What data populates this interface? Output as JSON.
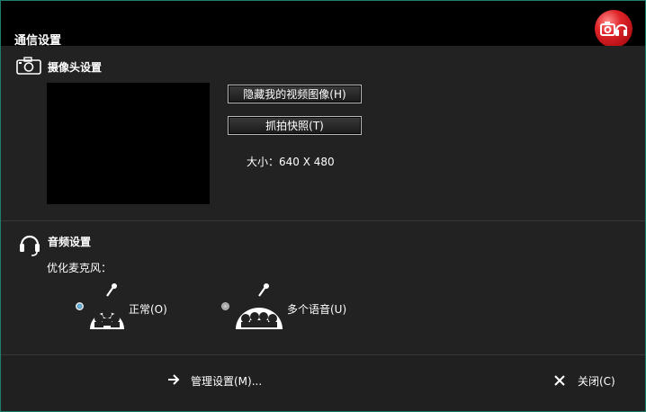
{
  "window": {
    "title": "通信设置"
  },
  "camera": {
    "section_title": "摄像头设置",
    "hide_video_button": "隐藏我的视频图像(H)",
    "snapshot_button": "抓拍快照(T)",
    "size_label": "大小：640 X 480"
  },
  "audio": {
    "section_title": "音频设置",
    "optimize_label": "优化麦克风：",
    "options": [
      {
        "label": "正常(O)",
        "selected": true
      },
      {
        "label": "多个语音(U)",
        "selected": false
      }
    ]
  },
  "footer": {
    "manage_label": "管理设置(M)...",
    "close_label": "关闭(C)"
  },
  "colors": {
    "border": "#1f7d6e",
    "background": "#202020",
    "accent": "#e0262a"
  },
  "icons": [
    "camera-icon",
    "headset-icon",
    "mic-group-icon",
    "arrow-right-icon",
    "close-icon",
    "app-logo-icon"
  ]
}
